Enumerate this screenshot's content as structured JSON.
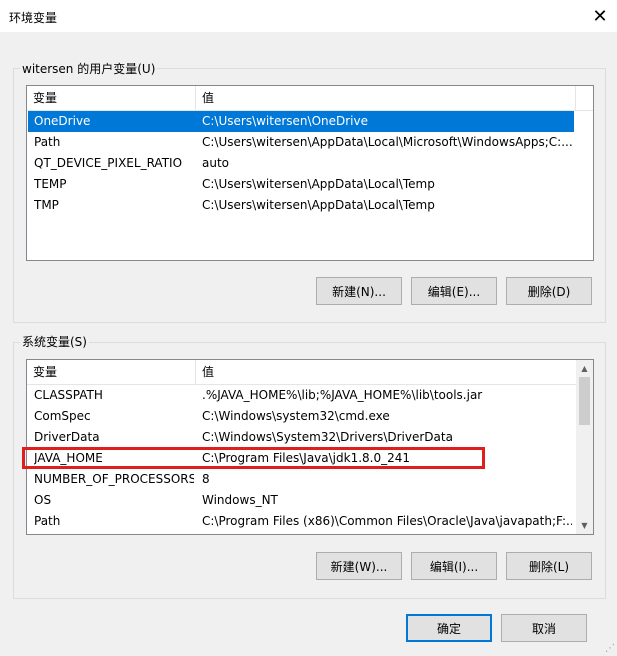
{
  "window": {
    "title": "环境变量",
    "close_glyph": "✕"
  },
  "user_vars": {
    "group_label": "witersen 的用户变量(U)",
    "header": {
      "name": "变量",
      "value": "值"
    },
    "rows": [
      {
        "name": "OneDrive",
        "value": "C:\\Users\\witersen\\OneDrive",
        "selected": true
      },
      {
        "name": "Path",
        "value": "C:\\Users\\witersen\\AppData\\Local\\Microsoft\\WindowsApps;C:..."
      },
      {
        "name": "QT_DEVICE_PIXEL_RATIO",
        "value": "auto"
      },
      {
        "name": "TEMP",
        "value": "C:\\Users\\witersen\\AppData\\Local\\Temp"
      },
      {
        "name": "TMP",
        "value": "C:\\Users\\witersen\\AppData\\Local\\Temp"
      }
    ],
    "buttons": {
      "new": "新建(N)...",
      "edit": "编辑(E)...",
      "delete": "删除(D)"
    }
  },
  "system_vars": {
    "group_label": "系统变量(S)",
    "header": {
      "name": "变量",
      "value": "值"
    },
    "rows": [
      {
        "name": "CLASSPATH",
        "value": ".%JAVA_HOME%\\lib;%JAVA_HOME%\\lib\\tools.jar"
      },
      {
        "name": "ComSpec",
        "value": "C:\\Windows\\system32\\cmd.exe"
      },
      {
        "name": "DriverData",
        "value": "C:\\Windows\\System32\\Drivers\\DriverData"
      },
      {
        "name": "JAVA_HOME",
        "value": "C:\\Program Files\\Java\\jdk1.8.0_241",
        "highlighted": true
      },
      {
        "name": "NUMBER_OF_PROCESSORS",
        "value": "8"
      },
      {
        "name": "OS",
        "value": "Windows_NT"
      },
      {
        "name": "Path",
        "value": "C:\\Program Files (x86)\\Common Files\\Oracle\\Java\\javapath;F:..."
      }
    ],
    "buttons": {
      "new": "新建(W)...",
      "edit": "编辑(I)...",
      "delete": "删除(L)"
    }
  },
  "footer": {
    "ok": "确定",
    "cancel": "取消"
  },
  "colors": {
    "selection": "#0078d7",
    "highlight_box": "#e01e1e"
  },
  "icons": {
    "scroll_up": "▲",
    "scroll_down": "▼"
  }
}
